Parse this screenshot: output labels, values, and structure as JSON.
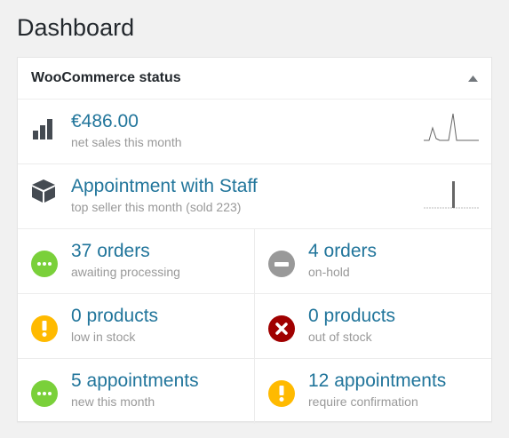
{
  "page": {
    "title": "Dashboard"
  },
  "widget": {
    "title": "WooCommerce status"
  },
  "net_sales": {
    "value": "€486.00",
    "label": "net sales this month"
  },
  "top_seller": {
    "value": "Appointment with Staff",
    "label": "top seller this month (sold 223)"
  },
  "orders_processing": {
    "value": "37 orders",
    "label": "awaiting processing"
  },
  "orders_onhold": {
    "value": "4 orders",
    "label": "on-hold"
  },
  "low_stock": {
    "value": "0 products",
    "label": "low in stock"
  },
  "out_of_stock": {
    "value": "0 products",
    "label": "out of stock"
  },
  "appointments_new": {
    "value": "5 appointments",
    "label": "new this month"
  },
  "appointments_confirm": {
    "value": "12 appointments",
    "label": "require confirmation"
  },
  "colors": {
    "link": "#21759b",
    "green": "#7ad03a",
    "grey": "#999999",
    "orange": "#ffba00",
    "red": "#a00000"
  },
  "icons": {
    "net_sales": "bar-chart-icon",
    "top_seller": "box-icon",
    "orders_processing": "ellipsis-circle-icon",
    "orders_onhold": "minus-circle-icon",
    "low_stock": "exclamation-circle-icon",
    "out_of_stock": "x-circle-icon",
    "appointments_new": "ellipsis-circle-icon",
    "appointments_confirm": "exclamation-circle-icon"
  }
}
